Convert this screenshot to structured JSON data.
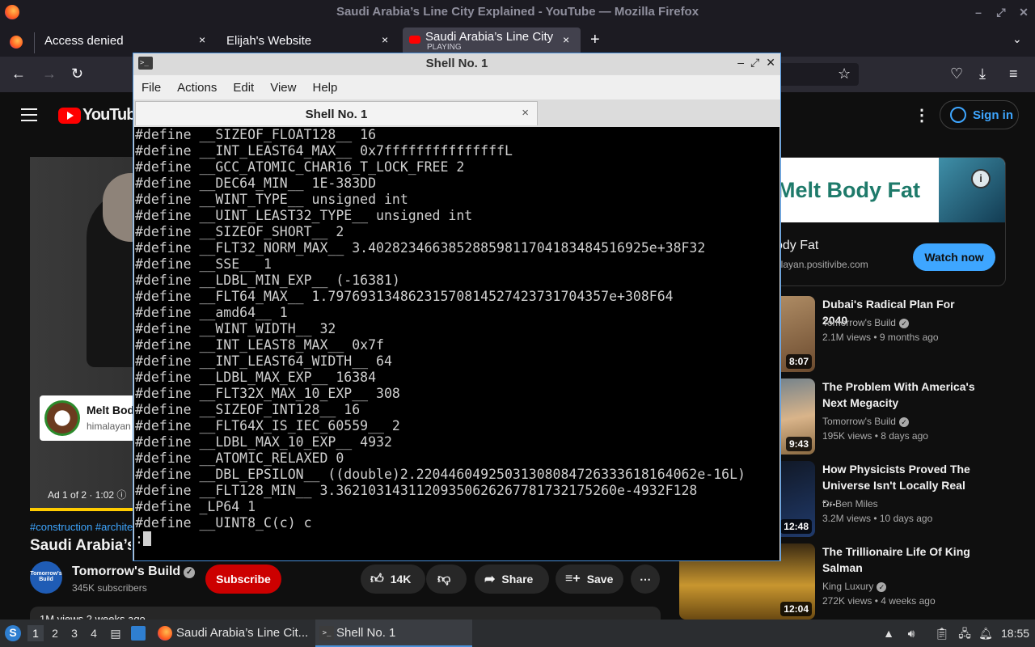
{
  "firefox": {
    "window_title": "Saudi Arabia’s Line City Explained - YouTube — Mozilla Firefox",
    "tabs": [
      {
        "label": "Access denied",
        "close": "×"
      },
      {
        "label": "Elijah's Website",
        "close": "×"
      },
      {
        "label": "Saudi Arabia’s Line City E",
        "sublabel": "PLAYING",
        "close": "×"
      }
    ],
    "new_tab": "+",
    "tab_list": "⌄",
    "nav": {
      "back": "←",
      "forward": "→",
      "reload": "↻",
      "bookmark": "☆",
      "pocket": "♡",
      "download": "⤓",
      "menu": "≡"
    }
  },
  "youtube": {
    "logo_text": "YouTube",
    "more": "⋮",
    "sign_in": "Sign in",
    "ad_card": {
      "title": "Melt Bod",
      "domain": "himalayan"
    },
    "ad_overlay": "Ad 1 of 2 · 1:02 ⓘ",
    "hashtags": "#construction #architect",
    "video_title": "Saudi Arabia’s L",
    "channel": {
      "avatar_text": "Tomorrow's Build",
      "name": "Tomorrow's Build",
      "verified": "✓",
      "subscribers": "345K subscribers"
    },
    "subscribe": "Subscribe",
    "actions": {
      "likes": "14K",
      "share": "Share",
      "save": "Save",
      "more": "⋯"
    },
    "description_peek": "1M views  2 weeks ago",
    "side_ad": {
      "headline": "Melt Body Fat",
      "title": "ody Fat",
      "domain": "alayan.positivibe.com",
      "cta": "Watch now",
      "info": "i"
    },
    "recommendations": [
      {
        "title": "Dubai's Radical Plan For 2040",
        "channel": "Tomorrow's Build",
        "meta": "2.1M views • 9 months ago",
        "duration": "8:07",
        "colors": [
          "#c9a67a",
          "#6b4a2e"
        ]
      },
      {
        "title": "The Problem With America's Next Megacity",
        "channel": "Tomorrow's Build",
        "meta": "195K views • 8 days ago",
        "duration": "9:43",
        "colors": [
          "#d9b48a",
          "#4d6f8c"
        ]
      },
      {
        "title": "How Physicists Proved The Universe Isn't Locally Real -...",
        "channel": "Dr Ben Miles",
        "meta": "3.2M views • 10 days ago",
        "duration": "12:48",
        "colors": [
          "#0b0b0b",
          "#203a6b"
        ]
      },
      {
        "title": "The Trillionaire Life Of King Salman",
        "channel": "King Luxury",
        "meta": "272K views • 4 weeks ago",
        "duration": "12:04",
        "colors": [
          "#c8962f",
          "#6b4a12"
        ]
      }
    ]
  },
  "terminal": {
    "window_title": "Shell No. 1",
    "menu": [
      "File",
      "Actions",
      "Edit",
      "View",
      "Help"
    ],
    "tab_label": "Shell No. 1",
    "tab_close": "×",
    "controls": {
      "minimize": "–",
      "maximize": "⤢",
      "close": "✕"
    },
    "lines": [
      "#define __SIZEOF_FLOAT128__ 16",
      "#define __INT_LEAST64_MAX__ 0x7fffffffffffffffL",
      "#define __GCC_ATOMIC_CHAR16_T_LOCK_FREE 2",
      "#define __DEC64_MIN__ 1E-383DD",
      "#define __WINT_TYPE__ unsigned int",
      "#define __UINT_LEAST32_TYPE__ unsigned int",
      "#define __SIZEOF_SHORT__ 2",
      "#define __FLT32_NORM_MAX__ 3.40282346638528859811704183484516925e+38F32",
      "#define __SSE__ 1",
      "#define __LDBL_MIN_EXP__ (-16381)",
      "#define __FLT64_MAX__ 1.79769313486231570814527423731704357e+308F64",
      "#define __amd64__ 1",
      "#define __WINT_WIDTH__ 32",
      "#define __INT_LEAST8_MAX__ 0x7f",
      "#define __INT_LEAST64_WIDTH__ 64",
      "#define __LDBL_MAX_EXP__ 16384",
      "#define __FLT32X_MAX_10_EXP__ 308",
      "#define __SIZEOF_INT128__ 16",
      "#define __FLT64X_IS_IEC_60559__ 2",
      "#define __LDBL_MAX_10_EXP__ 4932",
      "#define __ATOMIC_RELAXED 0",
      "#define __DBL_EPSILON__ ((double)2.22044604925031308084726333618164062e-16L)",
      "#define __FLT128_MIN__ 3.36210314311209350626267781732175260e-4932F128",
      "#define _LP64 1",
      "#define __UINT8_C(c) c"
    ],
    "prompt": ":"
  },
  "taskbar": {
    "workspaces": [
      "1",
      "2",
      "3",
      "4"
    ],
    "tasks": [
      {
        "label": "Saudi Arabia’s Line Cit..."
      },
      {
        "label": "Shell No. 1"
      }
    ],
    "clock": "18:55"
  }
}
